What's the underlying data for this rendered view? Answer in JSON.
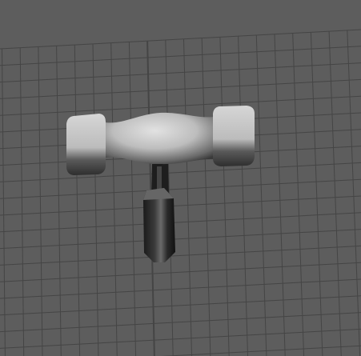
{
  "viewport": {
    "background_color": "#5d5d5d",
    "grid_color": "#454545",
    "model_icon": "hammer-model"
  }
}
